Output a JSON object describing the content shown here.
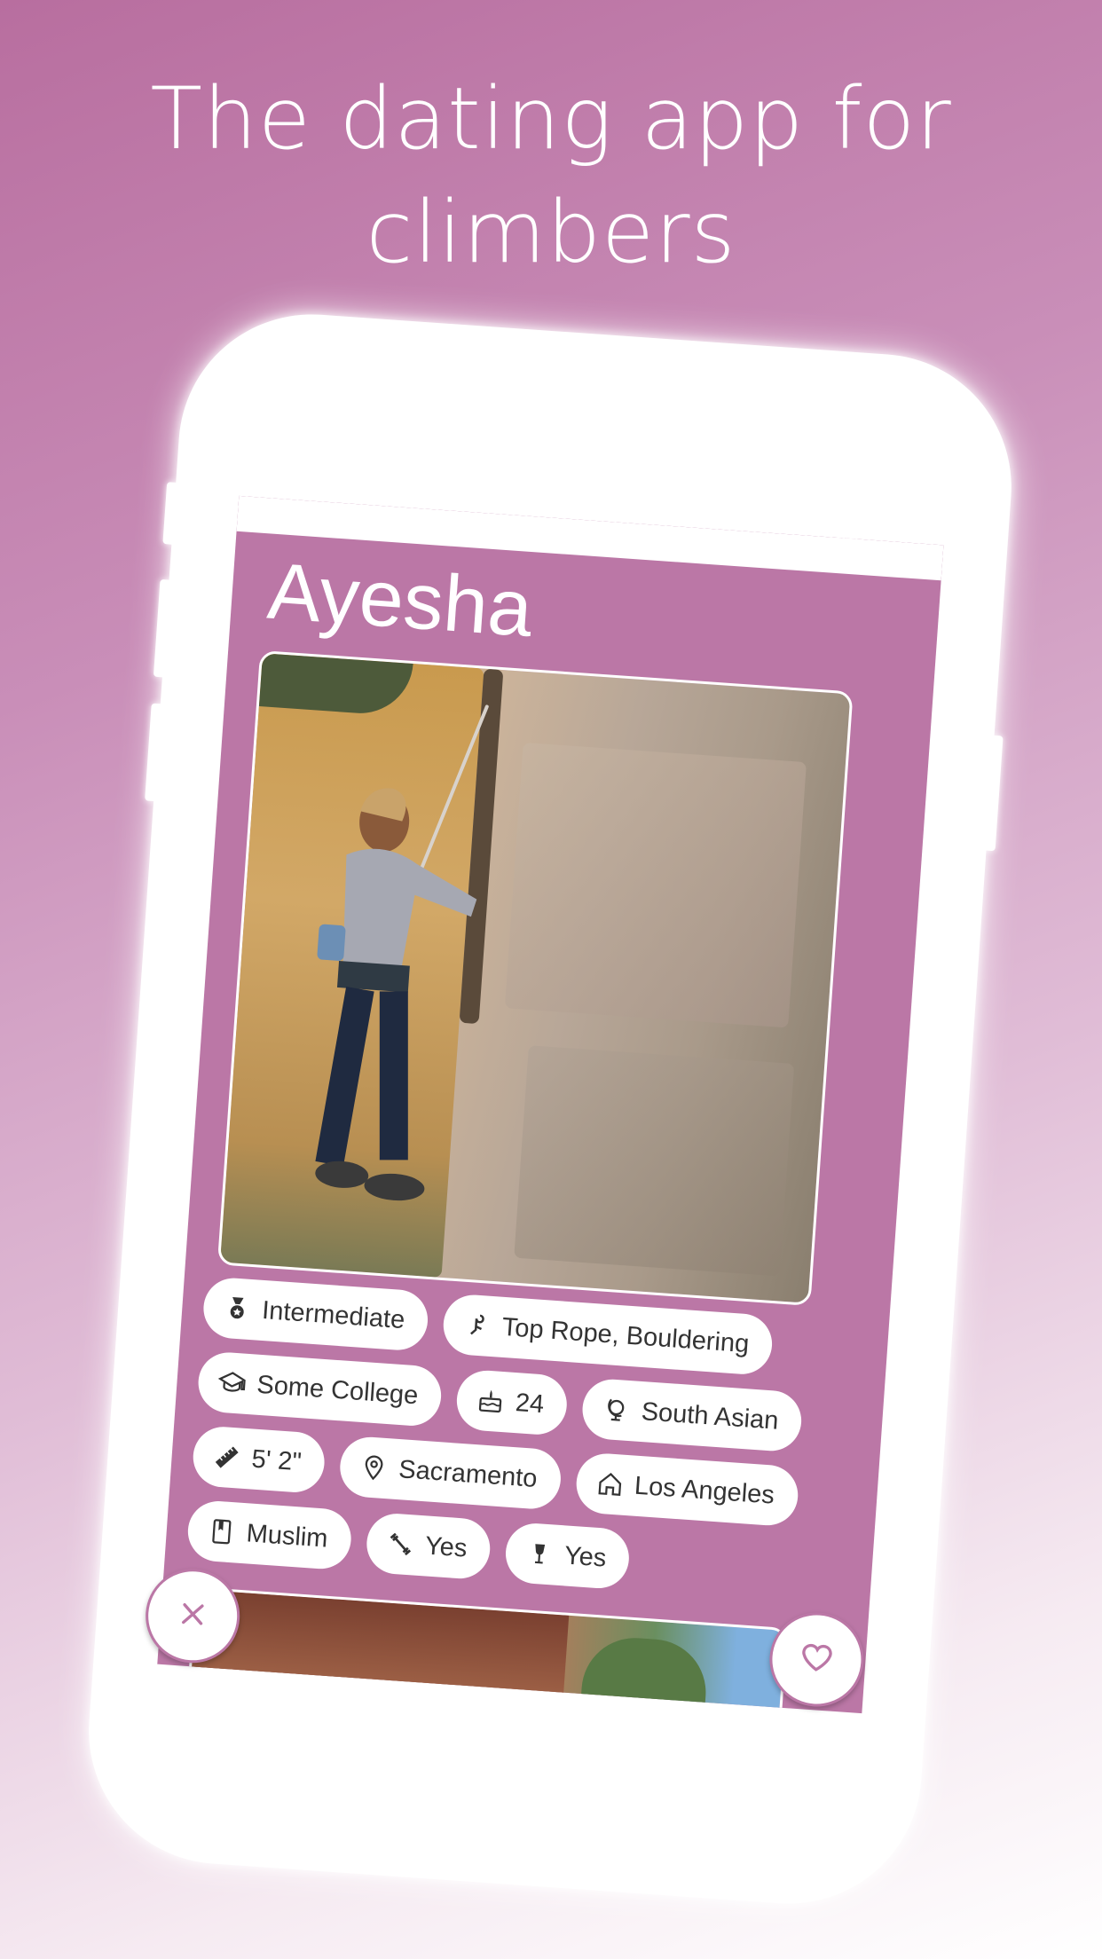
{
  "headline": "The dating app for climbers",
  "profile": {
    "name": "Ayesha"
  },
  "tags": [
    {
      "icon": "medal-icon",
      "label": "Intermediate"
    },
    {
      "icon": "climbing-hold-icon",
      "label": "Top Rope, Bouldering"
    },
    {
      "icon": "graduation-cap-icon",
      "label": "Some College"
    },
    {
      "icon": "birthday-cake-icon",
      "label": "24"
    },
    {
      "icon": "globe-icon",
      "label": "South Asian"
    },
    {
      "icon": "ruler-icon",
      "label": "5' 2\""
    },
    {
      "icon": "location-pin-icon",
      "label": "Sacramento"
    },
    {
      "icon": "home-icon",
      "label": "Los Angeles"
    },
    {
      "icon": "book-icon",
      "label": "Muslim"
    },
    {
      "icon": "dumbbell-icon",
      "label": "Yes"
    },
    {
      "icon": "wine-glass-icon",
      "label": "Yes"
    }
  ],
  "colors": {
    "accent": "#bb77a6",
    "background_top": "#b86e9f",
    "background_bottom": "#ffffff"
  },
  "actions": {
    "dislike_icon": "close-icon",
    "like_icon": "heart-icon"
  }
}
